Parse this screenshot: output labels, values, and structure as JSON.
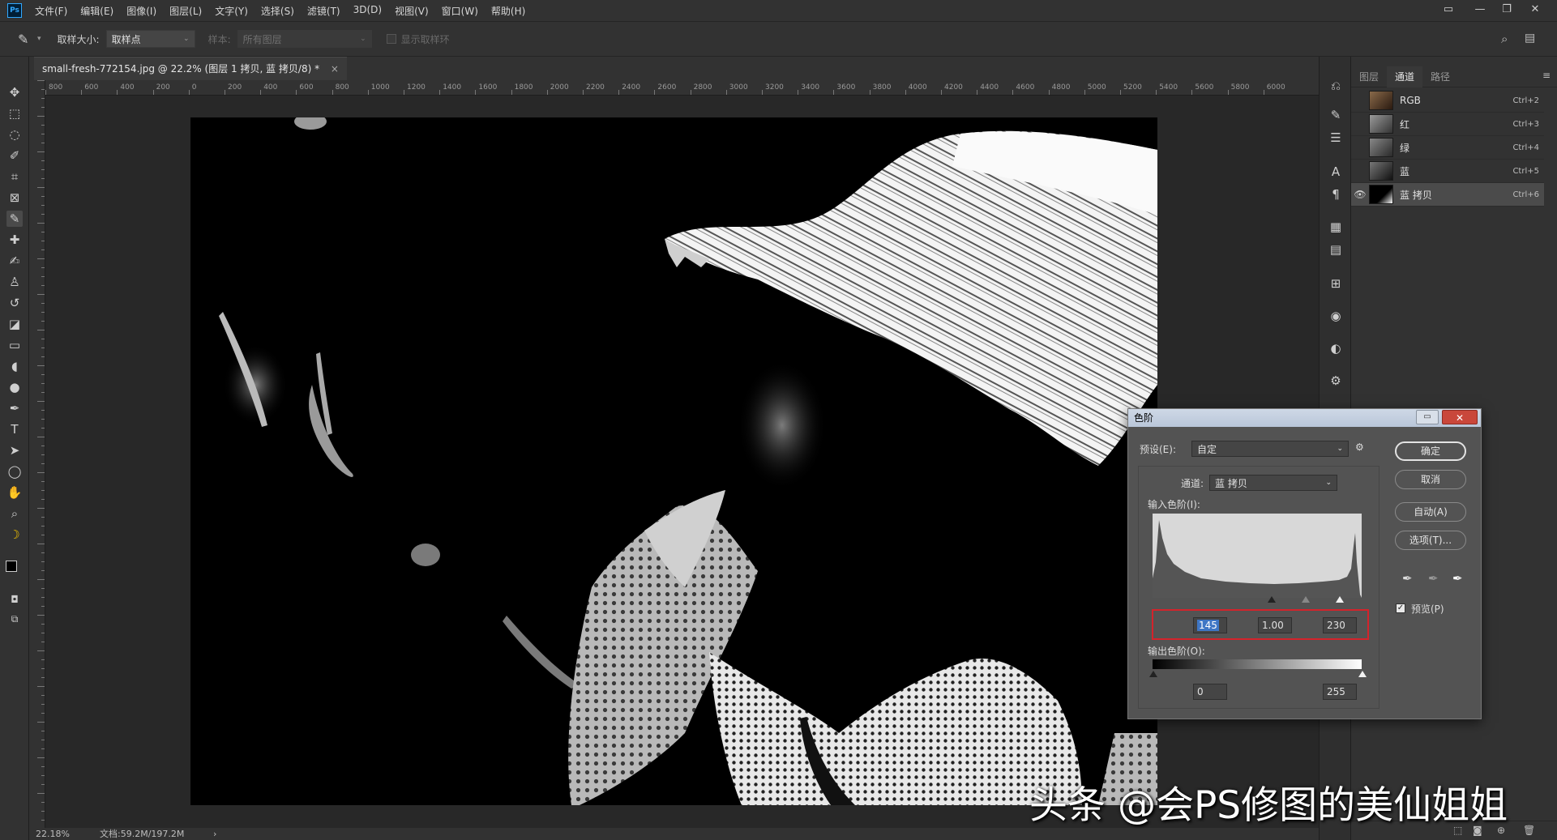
{
  "app": {
    "logo": "Ps"
  },
  "menubar": {
    "items": [
      "文件(F)",
      "编辑(E)",
      "图像(I)",
      "图层(L)",
      "文字(Y)",
      "选择(S)",
      "滤镜(T)",
      "3D(D)",
      "视图(V)",
      "窗口(W)",
      "帮助(H)"
    ]
  },
  "window_controls": {
    "minimize": "—",
    "restore": "❐",
    "close": "✕",
    "workspace": "▭"
  },
  "options": {
    "sample_size_label": "取样大小:",
    "sample_size_value": "取样点",
    "sample_label": "样本:",
    "sample_value": "所有图层",
    "show_ring_label": "显示取样环"
  },
  "document": {
    "tab_title": "small-fresh-772154.jpg @ 22.2% (图层 1 拷贝, 蓝 拷贝/8) *",
    "tab_close": "×",
    "ruler_ticks": [
      "800",
      "600",
      "400",
      "200",
      "0",
      "200",
      "400",
      "600",
      "800",
      "1000",
      "1200",
      "1400",
      "1600",
      "1800",
      "2000",
      "2200",
      "2400",
      "2600",
      "2800",
      "3000",
      "3200",
      "3400",
      "3600",
      "3800",
      "4000",
      "4200",
      "4400",
      "4600",
      "4800",
      "5000",
      "5200",
      "5400",
      "5600",
      "5800",
      "6000"
    ]
  },
  "status": {
    "zoom": "22.18%",
    "doc_size": "文档:59.2M/197.2M",
    "arrow": "›"
  },
  "channels_panel": {
    "tabs": [
      "图层",
      "通道",
      "路径"
    ],
    "active_tab": "通道",
    "channels": [
      {
        "name": "RGB",
        "shortcut": "Ctrl+2",
        "visible": false
      },
      {
        "name": "红",
        "shortcut": "Ctrl+3",
        "visible": false
      },
      {
        "name": "绿",
        "shortcut": "Ctrl+4",
        "visible": false
      },
      {
        "name": "蓝",
        "shortcut": "Ctrl+5",
        "visible": false
      },
      {
        "name": "蓝 拷贝",
        "shortcut": "Ctrl+6",
        "visible": true
      }
    ]
  },
  "levels_dialog": {
    "title": "色阶",
    "close": "✕",
    "preset_label": "预设(E):",
    "preset_value": "自定",
    "channel_label": "通道:",
    "channel_value": "蓝 拷贝",
    "input_levels_label": "输入色阶(I):",
    "input_black": "145",
    "input_gamma": "1.00",
    "input_white": "230",
    "output_levels_label": "输出色阶(O):",
    "output_black": "0",
    "output_white": "255",
    "buttons": {
      "ok": "确定",
      "cancel": "取消",
      "auto": "自动(A)",
      "options": "选项(T)..."
    },
    "preview_label": "预览(P)",
    "preview_checked": true
  },
  "watermark": "头条 @会PS修图的美仙姐姐"
}
